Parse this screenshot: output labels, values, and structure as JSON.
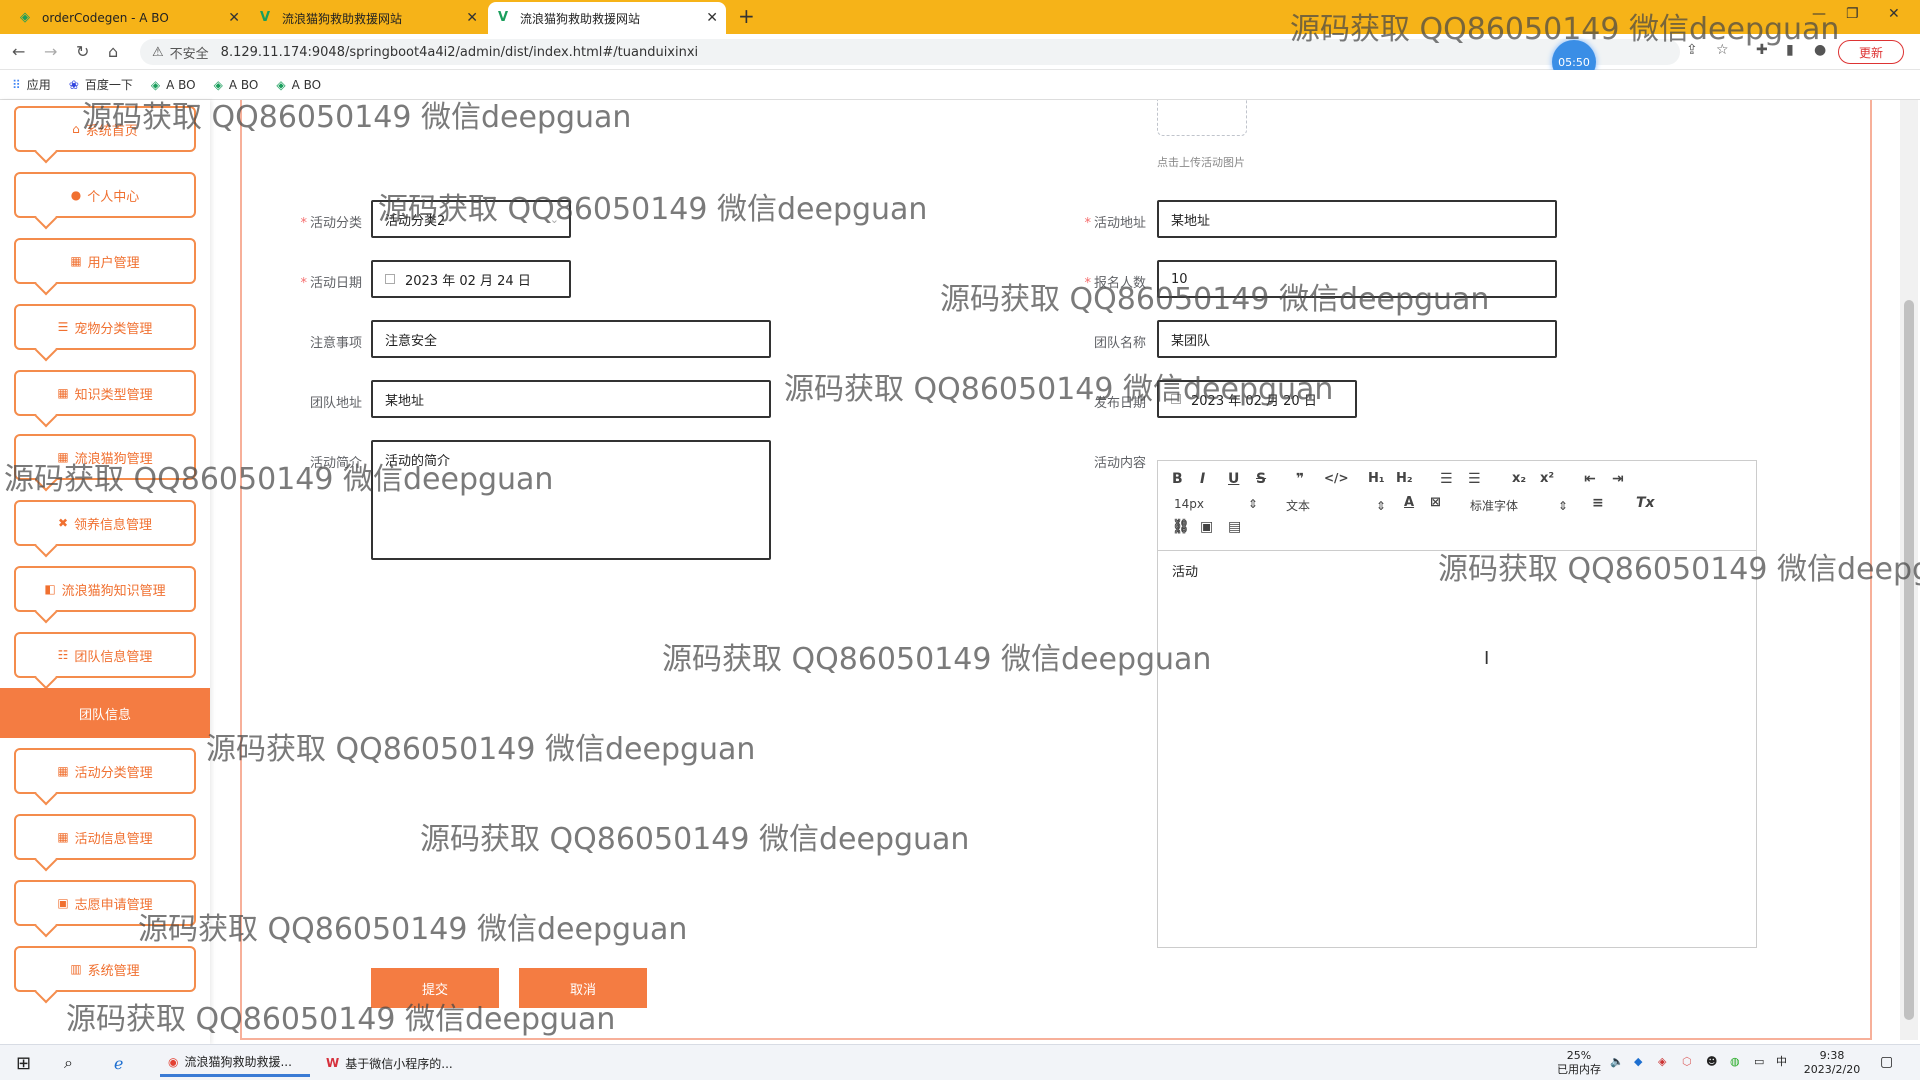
{
  "browser": {
    "tabs": [
      {
        "title": "orderCodegen - A BO",
        "active": false
      },
      {
        "title": "流浪猫狗救助救援网站",
        "active": false
      },
      {
        "title": "流浪猫狗救助救援网站",
        "active": true
      }
    ],
    "url": "8.129.11.174:9048/springboot4a4i2/admin/dist/index.html#/tuanduixinxi",
    "security_label": "不安全",
    "timer": "05:50",
    "update_label": "更新",
    "bookmarks": [
      "应用",
      "百度一下",
      "A BO",
      "A BO",
      "A BO"
    ]
  },
  "sidebar": {
    "items": [
      {
        "label": "系统首页",
        "icon": "home-icon"
      },
      {
        "label": "个人中心",
        "icon": "user-icon"
      },
      {
        "label": "用户管理",
        "icon": "grid-icon"
      },
      {
        "label": "宠物分类管理",
        "icon": "list-icon"
      },
      {
        "label": "知识类型管理",
        "icon": "grid-icon"
      },
      {
        "label": "流浪猫狗管理",
        "icon": "grid-icon"
      },
      {
        "label": "领养信息管理",
        "icon": "tag-icon"
      },
      {
        "label": "流浪猫狗知识管理",
        "icon": "book-icon"
      },
      {
        "label": "团队信息管理",
        "icon": "sliders-icon"
      },
      {
        "label": "活动分类管理",
        "icon": "grid-icon"
      },
      {
        "label": "活动信息管理",
        "icon": "grid-icon"
      },
      {
        "label": "志愿申请管理",
        "icon": "clipboard-icon"
      },
      {
        "label": "系统管理",
        "icon": "chart-icon"
      }
    ],
    "active_sub": "团队信息"
  },
  "form": {
    "upload_tip": "点击上传活动图片",
    "category_label": "活动分类",
    "category_value": "活动分类2",
    "address_label": "活动地址",
    "address_value": "某地址",
    "date_label": "活动日期",
    "date_value": "2023 年 02 月 24 日",
    "count_label": "报名人数",
    "count_value": "10",
    "notice_label": "注意事项",
    "notice_value": "注意安全",
    "team_name_label": "团队名称",
    "team_name_value": "某团队",
    "team_addr_label": "团队地址",
    "team_addr_value": "某地址",
    "publish_label": "发布日期",
    "publish_value": "2023 年 02 月 20 日",
    "intro_label": "活动简介",
    "intro_value": "活动的简介",
    "content_label": "活动内容",
    "content_value": "活动",
    "submit_label": "提交",
    "cancel_label": "取消"
  },
  "editor": {
    "font_size": "14px",
    "text_type": "文本",
    "font_family": "标准字体"
  },
  "watermark": "源码获取 QQ86050149 微信deepguan",
  "watermark_cut": "源码获取 QQ86050149 微信deepg",
  "taskbar": {
    "apps": [
      "流浪猫狗救助救援...",
      "基于微信小程序的..."
    ],
    "memory_pct": "25%",
    "memory_label": "已用内存",
    "ime": "中",
    "time": "9:38",
    "date": "2023/2/20"
  }
}
